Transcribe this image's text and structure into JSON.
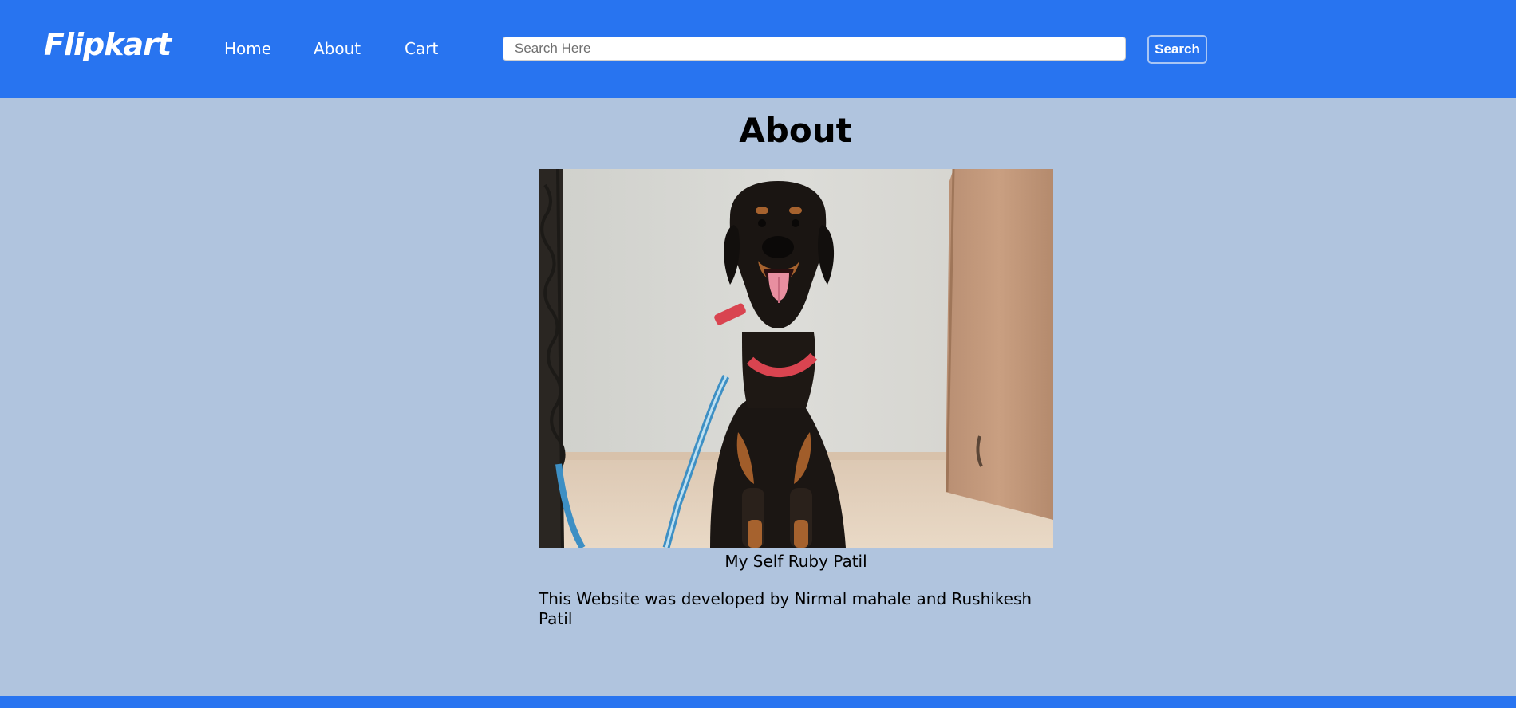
{
  "navbar": {
    "brand": "Flipkart",
    "links": [
      {
        "label": "Home"
      },
      {
        "label": "About"
      },
      {
        "label": "Cart"
      }
    ],
    "search": {
      "placeholder": "Search Here",
      "value": "",
      "button_label": "Search"
    }
  },
  "main": {
    "title": "About",
    "photo": {
      "icon": "dog-photo"
    },
    "caption": "My Self Ruby Patil",
    "credit": "This Website was developed by Nirmal mahale and Rushikesh Patil"
  },
  "colors": {
    "navbar": "#2874f0",
    "page_background": "#b0c4de",
    "text": "#000000"
  }
}
